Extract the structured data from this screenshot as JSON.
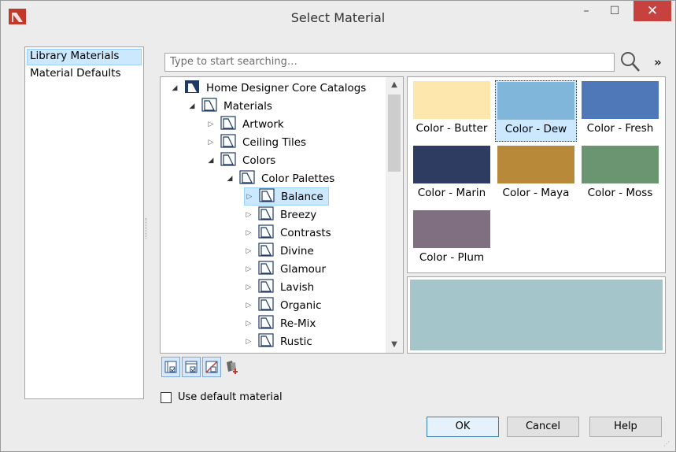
{
  "window": {
    "title": "Select Material"
  },
  "titlebar_buttons": {
    "minimize": "–",
    "maximize": "☐",
    "close": "✕"
  },
  "left_list": [
    "Library Materials",
    "Material Defaults"
  ],
  "search": {
    "placeholder": "Type to start searching…",
    "more": "»"
  },
  "tree": [
    {
      "label": "Home Designer Core Catalogs",
      "level": 0,
      "expanded": true
    },
    {
      "label": "Materials",
      "level": 1,
      "expanded": true
    },
    {
      "label": "Artwork",
      "level": 2,
      "expanded": false
    },
    {
      "label": "Ceiling Tiles",
      "level": 2,
      "expanded": false
    },
    {
      "label": "Colors",
      "level": 2,
      "expanded": true
    },
    {
      "label": "Color Palettes",
      "level": 3,
      "expanded": true
    },
    {
      "label": "Balance",
      "level": 4,
      "expanded": false,
      "selected": true
    },
    {
      "label": "Breezy",
      "level": 4,
      "expanded": false
    },
    {
      "label": "Contrasts",
      "level": 4,
      "expanded": false
    },
    {
      "label": "Divine",
      "level": 4,
      "expanded": false
    },
    {
      "label": "Glamour",
      "level": 4,
      "expanded": false
    },
    {
      "label": "Lavish",
      "level": 4,
      "expanded": false
    },
    {
      "label": "Organic",
      "level": 4,
      "expanded": false
    },
    {
      "label": "Re-Mix",
      "level": 4,
      "expanded": false
    },
    {
      "label": "Rustic",
      "level": 4,
      "expanded": false
    }
  ],
  "swatches": [
    {
      "label": "Color - Butter",
      "color": "#fde7ad"
    },
    {
      "label": "Color - Dew",
      "color": "#81b6db",
      "selected": true
    },
    {
      "label": "Color - Fresh",
      "color": "#4f78b8"
    },
    {
      "label": "Color - Marin",
      "color": "#2f3c61"
    },
    {
      "label": "Color - Maya",
      "color": "#b88938"
    },
    {
      "label": "Color - Moss",
      "color": "#6a9570"
    },
    {
      "label": "Color - Plum",
      "color": "#7f6f80"
    }
  ],
  "preview": {
    "color": "#a4c6cb"
  },
  "checkbox": {
    "label": "Use default material",
    "checked": false
  },
  "buttons": {
    "ok": "OK",
    "cancel": "Cancel",
    "help": "Help"
  },
  "colors": {
    "accent": "#c7413f",
    "selection": "#cce8ff",
    "brand": "#c0392b"
  }
}
